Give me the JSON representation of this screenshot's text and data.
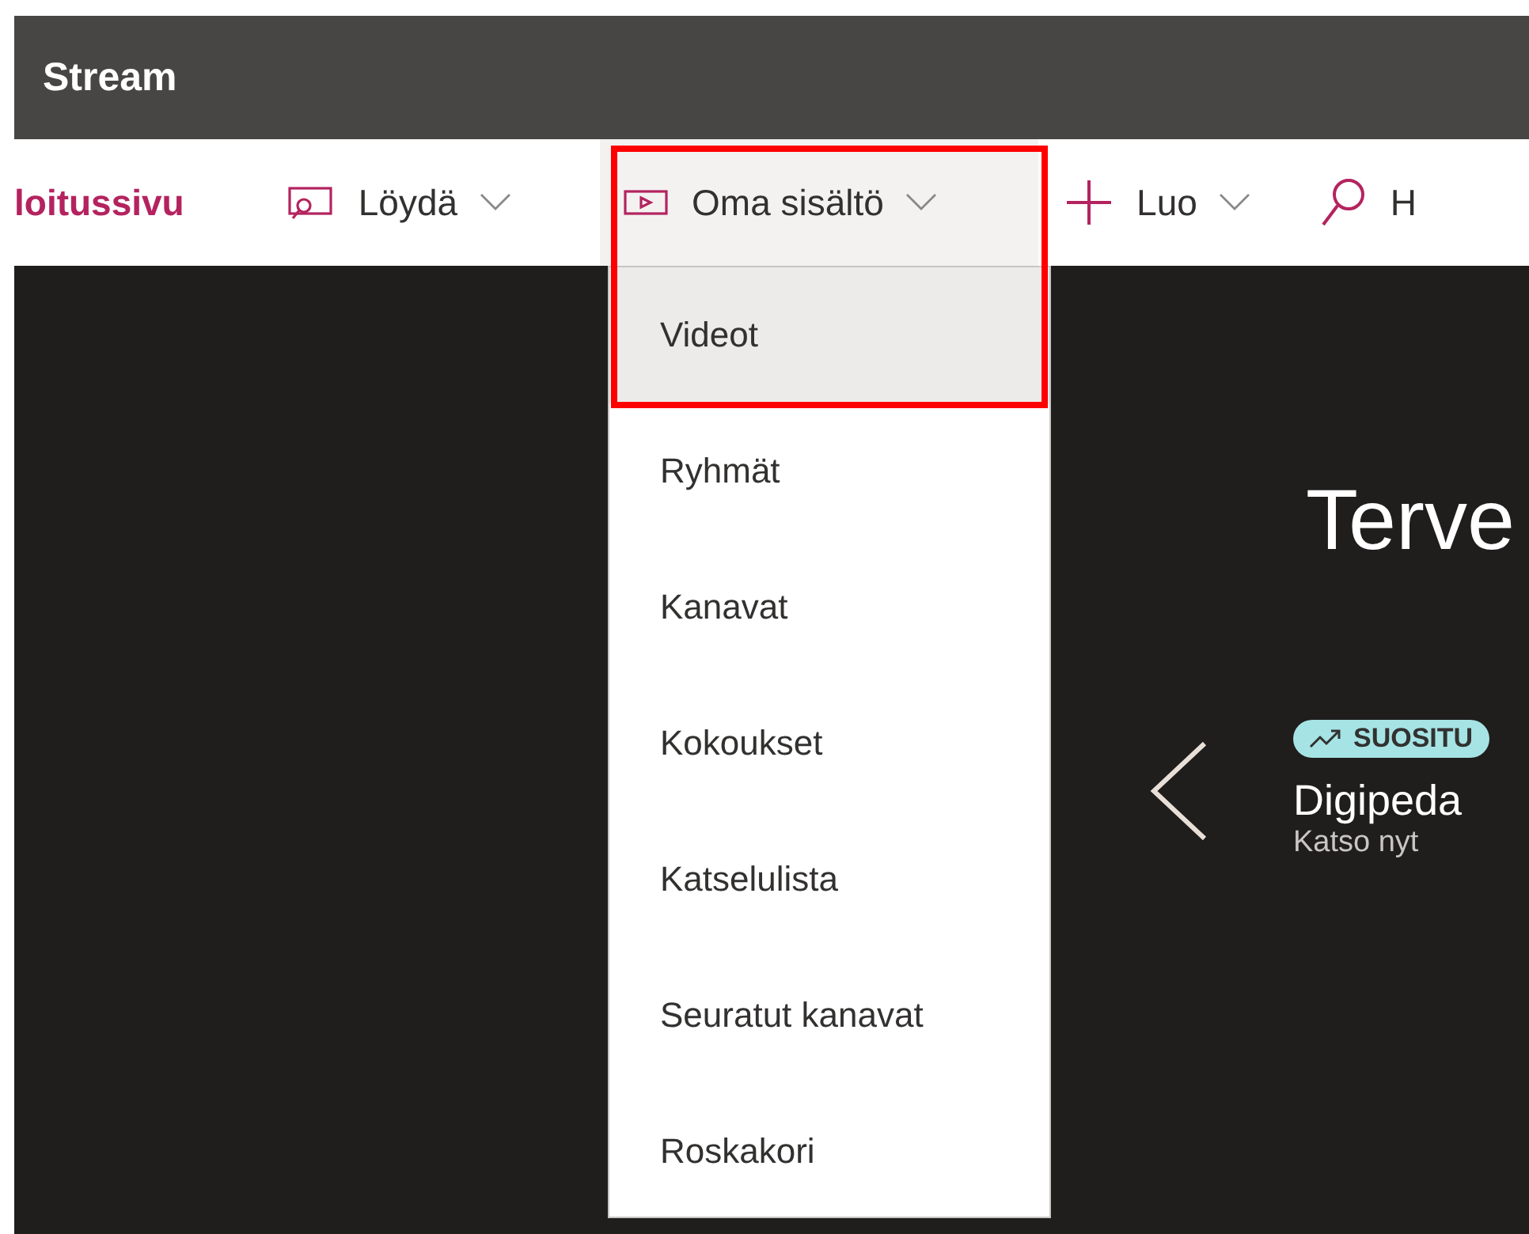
{
  "app": {
    "title": "Stream"
  },
  "nav": [
    {
      "kind": "home",
      "label": "loitussivu",
      "selected": false,
      "dropdown": false
    },
    {
      "kind": "discover",
      "label": "Löydä",
      "selected": false,
      "dropdown": true
    },
    {
      "kind": "mycontent",
      "label": "Oma sisältö",
      "selected": true,
      "dropdown": true
    },
    {
      "kind": "create",
      "label": "Luo",
      "selected": false,
      "dropdown": true
    },
    {
      "kind": "search",
      "label": "H",
      "selected": false,
      "dropdown": false
    }
  ],
  "menu": [
    {
      "label": "Videot",
      "selected": true
    },
    {
      "label": "Ryhmät",
      "selected": false
    },
    {
      "label": "Kanavat",
      "selected": false
    },
    {
      "label": "Kokoukset",
      "selected": false
    },
    {
      "label": "Katselulista",
      "selected": false
    },
    {
      "label": "Seuratut kanavat",
      "selected": false
    },
    {
      "label": "Roskakori",
      "selected": false
    }
  ],
  "hero": {
    "heading": "Terve",
    "badge": "SUOSITU",
    "title": "Digipeda",
    "link": "Katso nyt"
  }
}
